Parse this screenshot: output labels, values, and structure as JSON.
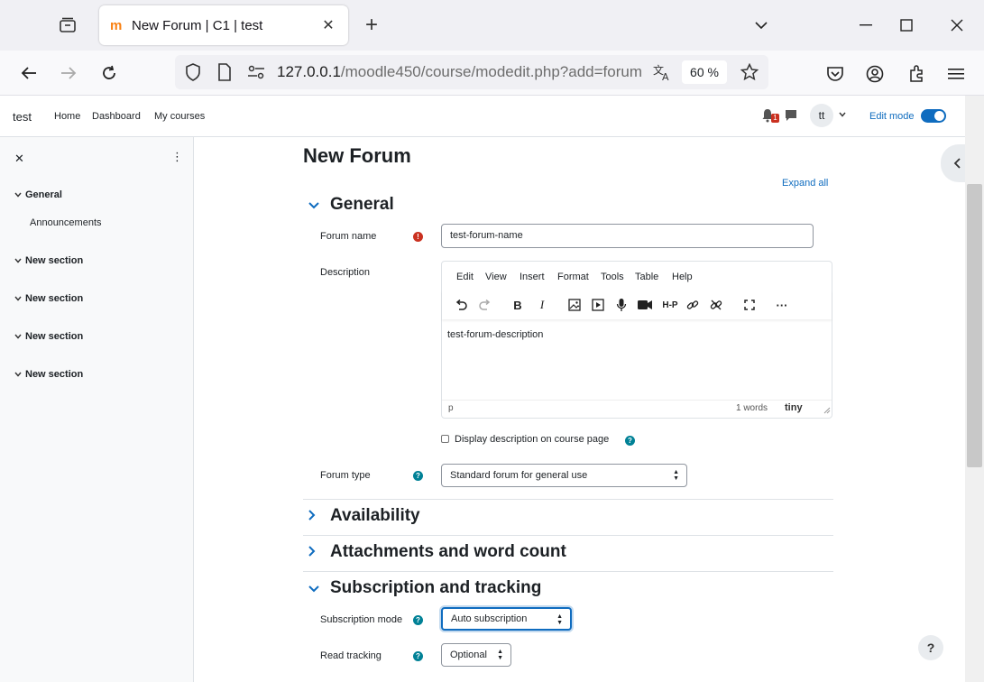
{
  "browser": {
    "tab_title": "New Forum | C1 | test",
    "url_host": "127.0.0.1",
    "url_path": "/moodle450/course/modedit.php?add=forum",
    "zoom": "60 %"
  },
  "header": {
    "site_name": "test",
    "nav": [
      "Home",
      "Dashboard",
      "My courses"
    ],
    "notification_count": "1",
    "avatar_initials": "tt",
    "edit_mode_label": "Edit mode"
  },
  "drawer": {
    "sections": [
      {
        "label": "General",
        "items": [
          "Announcements"
        ]
      },
      {
        "label": "New section"
      },
      {
        "label": "New section"
      },
      {
        "label": "New section"
      },
      {
        "label": "New section"
      }
    ]
  },
  "page": {
    "title": "New Forum",
    "expand_all": "Expand all"
  },
  "general": {
    "heading": "General",
    "forum_name_label": "Forum name",
    "forum_name_value": "test-forum-name",
    "description_label": "Description",
    "editor_menu": [
      "Edit",
      "View",
      "Insert",
      "Format",
      "Tools",
      "Table",
      "Help"
    ],
    "editor_content": "test-forum-description",
    "editor_path": "p",
    "editor_wordcount": "1 words",
    "editor_brand": "tiny",
    "display_desc_label": "Display description on course page",
    "forum_type_label": "Forum type",
    "forum_type_value": "Standard forum for general use"
  },
  "sections": {
    "availability": "Availability",
    "attachments": "Attachments and word count",
    "subscription": "Subscription and tracking"
  },
  "subscription": {
    "mode_label": "Subscription mode",
    "mode_value": "Auto subscription",
    "tracking_label": "Read tracking",
    "tracking_value": "Optional"
  },
  "colors": {
    "primary": "#0f6cbf",
    "required": "#ca3120",
    "help": "#008196"
  }
}
